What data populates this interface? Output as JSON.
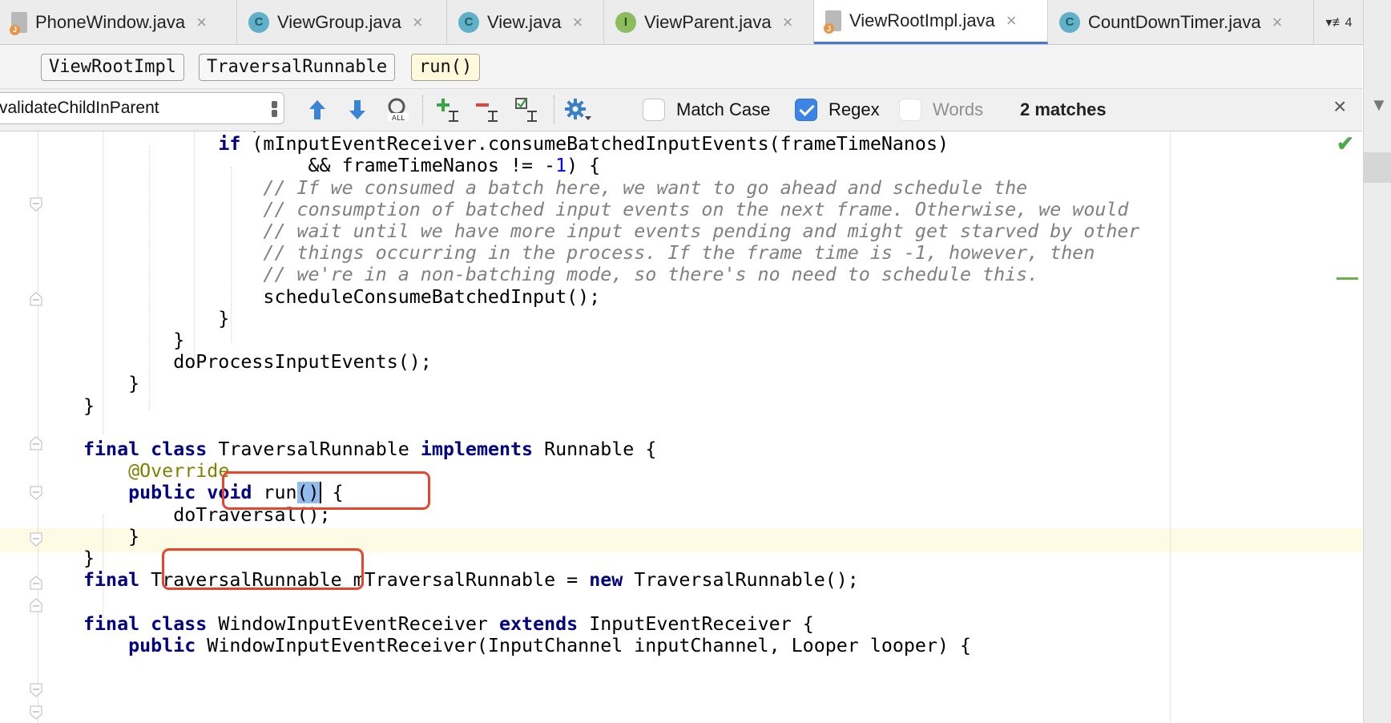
{
  "tabs": [
    {
      "label": "PhoneWindow.java",
      "icon": "java-file-icon"
    },
    {
      "label": "ViewGroup.java",
      "icon": "class-icon",
      "letter": "C"
    },
    {
      "label": "View.java",
      "icon": "class-icon",
      "letter": "C"
    },
    {
      "label": "ViewParent.java",
      "icon": "interface-icon",
      "letter": "I"
    },
    {
      "label": "ViewRootImpl.java",
      "icon": "java-file-icon",
      "active": true
    },
    {
      "label": "CountDownTimer.java",
      "icon": "class-icon",
      "letter": "C"
    }
  ],
  "tab_close_glyph": "×",
  "tab_overflow": "▾≢4",
  "breadcrumbs": [
    "ViewRootImpl",
    "TraversalRunnable",
    "run()"
  ],
  "find": {
    "query": "validateChildInParent",
    "options": [
      {
        "label": "Match Case",
        "checked": false
      },
      {
        "label": "Regex",
        "checked": true
      },
      {
        "label": "Words",
        "checked": false,
        "disabled": true
      }
    ],
    "match_count": "2 matches",
    "close_glyph": "×"
  },
  "code": {
    "lines": [
      "        if (mInputEventReceiver != null) {",
      "            if (mInputEventReceiver.consumeBatchedInputEvents(frameTimeNanos)",
      "                    && frameTimeNanos != -1) {",
      "                // If we consumed a batch here, we want to go ahead and schedule the",
      "                // consumption of batched input events on the next frame. Otherwise, we would",
      "                // wait until we have more input events pending and might get starved by other",
      "                // things occurring in the process. If the frame time is -1, however, then",
      "                // we're in a non-batching mode, so there's no need to schedule this.",
      "                scheduleConsumeBatchedInput();",
      "            }",
      "        }",
      "        doProcessInputEvents();",
      "    }",
      "}",
      "",
      "final class TraversalRunnable implements Runnable {",
      "    @Override",
      "    public void run() {",
      "        doTraversal();",
      "    }",
      "}",
      "final TraversalRunnable mTraversalRunnable = new TraversalRunnable();",
      "",
      "final class WindowInputEventReceiver extends InputEventReceiver {",
      "    public WindowInputEventReceiver(InputChannel inputChannel, Looper looper) {"
    ]
  },
  "colors": {
    "keyword": "#000080",
    "number": "#0000ff",
    "comment": "#808080",
    "annotation": "#808000",
    "caret_row": "#fffae3",
    "highlight_box": "#e8442e",
    "active_tab_underline": "#4a78c8"
  }
}
